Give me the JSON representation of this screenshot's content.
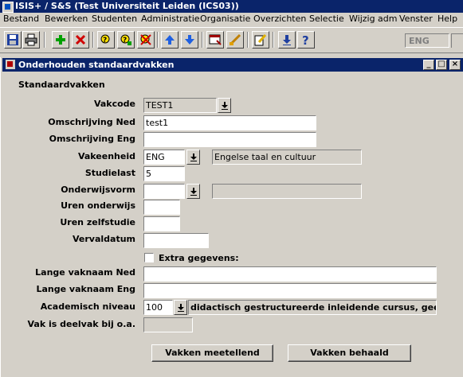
{
  "app": {
    "title": "ISIS+ / S&S  (Test Universiteit Leiden (ICS03))"
  },
  "menu": {
    "items": [
      "Bestand",
      "Bewerken",
      "Studenten",
      "Administratie",
      "Organisatie",
      "Overzichten",
      "Selectie",
      "Wijzig adm",
      "Venster",
      "Help"
    ]
  },
  "toolbar": {
    "language": "ENG",
    "icons": [
      "save-icon",
      "print-icon",
      "add-record-icon",
      "delete-record-icon",
      "query-icon",
      "query-execute-icon",
      "query-cancel-icon",
      "previous-record-icon",
      "next-record-icon",
      "list-icon",
      "clear-icon",
      "edit-icon",
      "download-icon",
      "help-icon"
    ]
  },
  "window": {
    "title": "Onderhouden standaardvakken"
  },
  "form": {
    "section": "Standaardvakken",
    "vakcode": {
      "label": "Vakcode",
      "value": "TEST1"
    },
    "omschrijving_ned": {
      "label": "Omschrijving Ned",
      "value": "test1"
    },
    "omschrijving_eng": {
      "label": "Omschrijving Eng",
      "value": ""
    },
    "vakeenheid": {
      "label": "Vakeenheid",
      "value": "ENG",
      "description": "Engelse taal en cultuur"
    },
    "studielast": {
      "label": "Studielast",
      "value": "5"
    },
    "onderwijsvorm": {
      "label": "Onderwijsvorm",
      "value": "",
      "description": ""
    },
    "uren_onderwijs": {
      "label": "Uren onderwijs",
      "value": ""
    },
    "uren_zelfstudie": {
      "label": "Uren zelfstudie",
      "value": ""
    },
    "vervaldatum": {
      "label": "Vervaldatum",
      "value": ""
    },
    "extra_gegevens": {
      "label": "Extra gegevens",
      "checked": false
    },
    "lange_vaknaam_ned": {
      "label": "Lange vaknaam Ned",
      "value": ""
    },
    "lange_vaknaam_eng": {
      "label": "Lange vaknaam Eng",
      "value": ""
    },
    "academisch_niveau": {
      "label": "Academisch niveau",
      "value": "100",
      "description": "didactisch gestructureerde inleidende cursus, geen sp"
    },
    "vak_deelvak": {
      "label": "Vak is deelvak bij o.a.",
      "value": ""
    }
  },
  "buttons": {
    "vakken_meetellend": "Vakken meetellend",
    "vakken_behaald": "Vakken behaald"
  },
  "colors": {
    "titlebar": "#0a246a",
    "face": "#d4d0c8"
  }
}
